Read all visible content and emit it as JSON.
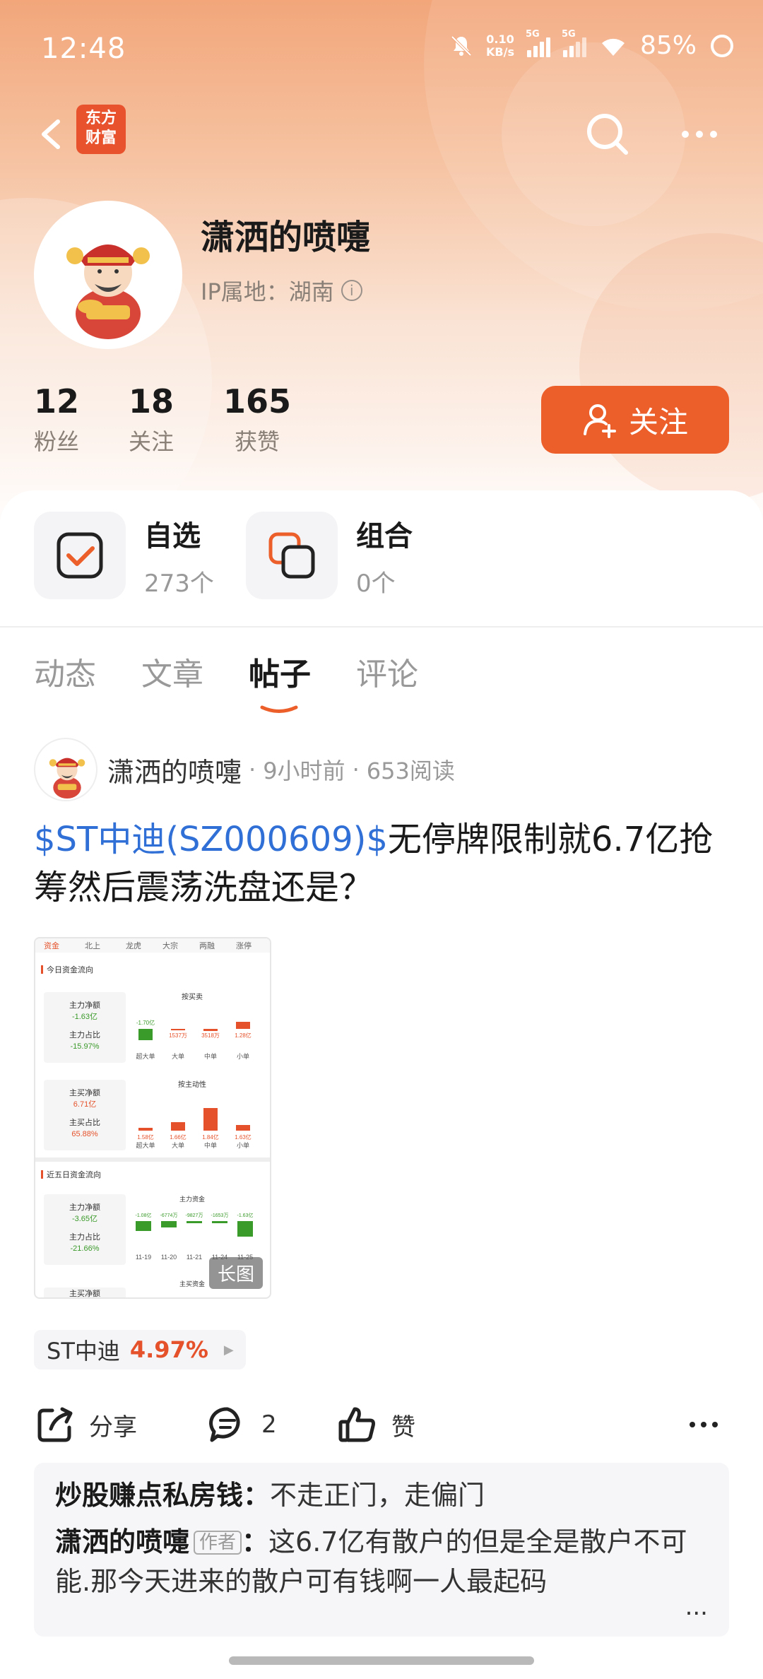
{
  "status_bar": {
    "time": "12:48",
    "net_speed_value": "0.10",
    "net_speed_unit": "KB/s",
    "signal1_label": "5G",
    "signal2_label": "5G",
    "battery": "85%"
  },
  "nav": {
    "logo_line1": "东方",
    "logo_line2": "财富"
  },
  "profile": {
    "name": "潇洒的喷嚏",
    "ip_location": "IP属地：湖南",
    "stats": [
      {
        "value": "12",
        "label": "粉丝"
      },
      {
        "value": "18",
        "label": "关注"
      },
      {
        "value": "165",
        "label": "获赞"
      }
    ],
    "follow_label": "关注"
  },
  "shortcuts": [
    {
      "title": "自选",
      "sub": "273个"
    },
    {
      "title": "组合",
      "sub": "0个"
    }
  ],
  "tabs": [
    "动态",
    "文章",
    "帖子",
    "评论"
  ],
  "active_tab_index": 2,
  "post": {
    "author": "潇洒的喷嚏",
    "time": "9小时前",
    "reads": "653阅读",
    "stock_tag": "$ST中迪(SZ000609)$",
    "title_rest": "无停牌限制就6.7亿抢筹然后震荡洗盘还是？",
    "image_badge": "长图",
    "stock_chip": {
      "name": "ST中迪",
      "change": "4.97%"
    },
    "actions": {
      "share": "分享",
      "comments": "2",
      "like": "赞"
    }
  },
  "comments": [
    {
      "user": "炒股赚点私房钱",
      "text": "不走正门，走偏门"
    },
    {
      "user": "潇洒的喷嚏",
      "tag": "作者",
      "text": "这6.7亿有散户的但是全是散户不可能.那今天进来的散户可有钱啊一人最起码"
    }
  ],
  "comment_more": "...",
  "thumbnail": {
    "tabs": [
      "资金",
      "北上",
      "龙虎",
      "大宗",
      "两融",
      "涨停"
    ],
    "section1": "今日资金流向",
    "box1": {
      "l1": "主力净额",
      "v1": "-1.63亿",
      "l2": "主力占比",
      "v2": "-15.97%"
    },
    "chart1_title": "按买卖",
    "chart1_vals": [
      "-1.70亿",
      "1537万",
      "3518万",
      "1.28亿"
    ],
    "chart_cats": [
      "超大单",
      "大单",
      "中单",
      "小单"
    ],
    "box2": {
      "l1": "主买净额",
      "v1": "6.71亿",
      "l2": "主买占比",
      "v2": "65.88%"
    },
    "chart2_title": "按主动性",
    "chart2_vals": [
      "1.58亿",
      "1.66亿",
      "1.84亿",
      "1.63亿"
    ],
    "section2": "近五日资金流向",
    "box3": {
      "l1": "主力净额",
      "v1": "-3.65亿",
      "l2": "主力占比",
      "v2": "-21.66%"
    },
    "chart3_title": "主力资金",
    "chart3_vals": [
      "-1.08亿",
      "-6774万",
      "-9827万",
      "-1653万",
      "-1.63亿"
    ],
    "chart3_dates": [
      "11-19",
      "11-20",
      "11-21",
      "11-24",
      "11-25"
    ],
    "footer_label": "主买资金",
    "box4_l1": "主买净额"
  },
  "colors": {
    "accent": "#ec5f2a",
    "link": "#2f6fd6",
    "up": "#e5512a",
    "down": "#3a9a2a"
  }
}
